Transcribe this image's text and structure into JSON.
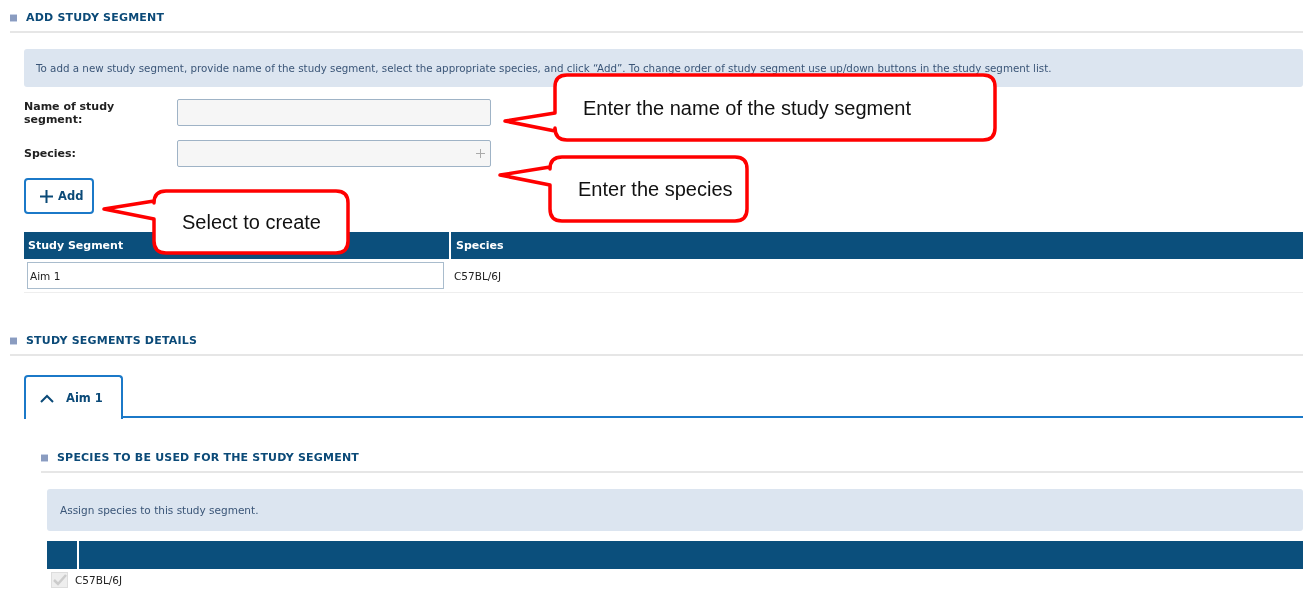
{
  "add_section": {
    "title": "ADD STUDY SEGMENT",
    "info": "To add a new study segment, provide name of the study segment, select the appropriate species, and click “Add”. To change order of study segment use up/down buttons in the study segment list.",
    "fields": [
      {
        "label": "Name of study segment:",
        "kind": "text"
      },
      {
        "label": "Species:",
        "kind": "picker"
      }
    ],
    "add_button": "Add",
    "table": {
      "columns": [
        "Study Segment",
        "Species"
      ],
      "rows": [
        {
          "study_segment": "Aim 1",
          "species": "C57BL/6J"
        }
      ]
    }
  },
  "details_section": {
    "title": "STUDY SEGMENTS DETAILS",
    "tabs": [
      {
        "label": "Aim 1",
        "selected": true,
        "expanded": true
      }
    ],
    "subsection": {
      "title": "SPECIES TO BE USED FOR THE STUDY SEGMENT",
      "info": "Assign species to this study segment.",
      "rows": [
        {
          "label": "C57BL/6J",
          "checked": true,
          "disabled": true
        }
      ]
    }
  },
  "callouts": [
    {
      "text": "Enter the name of the study segment"
    },
    {
      "text": "Enter the species"
    },
    {
      "text": "Select to create"
    }
  ]
}
